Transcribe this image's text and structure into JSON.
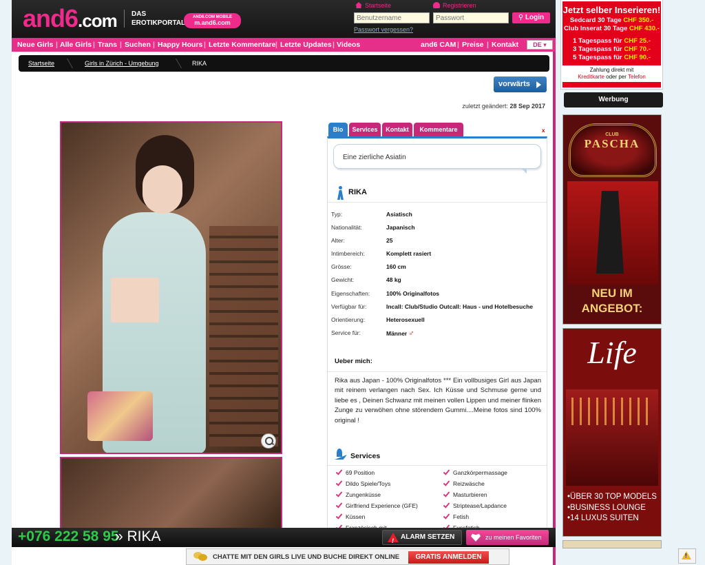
{
  "header": {
    "logo": "and6",
    "logo_tld": ".com",
    "tagline_1": "DAS",
    "tagline_2": "EROTIKPORTAL",
    "mobile_top": "AND6.COM MOBILE",
    "mobile_url": "m.and6.com",
    "link_home": "Startseite",
    "link_register": "Registrieren",
    "username_placeholder": "Benutzername",
    "password_placeholder": "Passwort",
    "login_label": "Login",
    "forgot_label": "Passwort vergessen?"
  },
  "nav": {
    "items": [
      "Neue Girls",
      "Alle Girls",
      "Trans",
      "Suchen",
      "Happy Hours",
      "Letzte Kommentare",
      "Letzte Updates",
      "Videos"
    ],
    "right_items": [
      "and6 CAM",
      "Preise",
      "Kontakt"
    ],
    "lang": "DE"
  },
  "breadcrumb": [
    "Startseite",
    "Girls in Zürich - Umgebung",
    "RIKA"
  ],
  "forward_label": "vorwärts",
  "modified_prefix": "zuletzt geändert:",
  "modified_date": "28 Sep 2017",
  "tabs": [
    "Bio",
    "Services",
    "Kontakt",
    "Kommentare"
  ],
  "tab_close": "x",
  "profile": {
    "tagline": "Eine zierliche Asiatin",
    "name": "RIKA",
    "attributes": [
      {
        "k": "Typ:",
        "v": "Asiatisch"
      },
      {
        "k": "Nationalität:",
        "v": "Japanisch"
      },
      {
        "k": "Alter:",
        "v": "25"
      },
      {
        "k": "Intimbereich:",
        "v": "Komplett rasiert"
      },
      {
        "k": "Grösse:",
        "v": "160 cm"
      },
      {
        "k": "Gewicht:",
        "v": "48 kg"
      },
      {
        "k": "Eigenschaften:",
        "v": "100% Originalfotos"
      },
      {
        "k": "Verfügbar für:",
        "v": "Incall: Club/Studio Outcall: Haus - und Hotelbesuche"
      },
      {
        "k": "Orientierung:",
        "v": "Heterosexuell"
      },
      {
        "k": "Service für:",
        "v": "Männer"
      }
    ],
    "about_title": "Ueber mich:",
    "about_text": "Rika aus Japan - 100% Originalfotos *** Ein vollbusiges Girl aus Japan mit reinem verlangen nach Sex. Ich Küsse und Schmuse gerne und liebe es , Deinen Schwanz mit meinen vollen Lippen und meiner flinken Zunge zu verwöhen ohne störendem Gummi....Meine fotos sind 100% original !",
    "services_title": "Services",
    "services_left": [
      "69 Position",
      "Dildo Spiele/Toys",
      "Zungenküsse",
      "Girlfriend Experience (GFE)",
      "Küssen",
      "Französisch mit"
    ],
    "services_right": [
      "Ganzkörpermassage",
      "Reizwäsche",
      "Masturbieren",
      "Striptease/Lapdance",
      "Fetish",
      "Fussfetish"
    ]
  },
  "bottom_bar": {
    "phone": "+076 222 58 95",
    "name": "» RIKA",
    "alarm_label": "ALARM SETZEN",
    "fav_label": "zu meinen Favoriten"
  },
  "chat_bar": {
    "text": "CHATTE MIT DEN GIRLS LIVE UND BUCHE DIREKT ONLINE",
    "button": "GRATIS ANMELDEN"
  },
  "ads": {
    "top_title": "Jetzt selber Inserieren!",
    "top_line1": "Sedcard 30 Tage",
    "top_line1_price": "CHF 350.-",
    "top_line2": "Club Inserat 30 Tage",
    "top_line2_price": "CHF 430.-",
    "pass1": "1 Tagespass für",
    "pass1_price": "CHF 25.-",
    "pass2": "3 Tagespass für",
    "pass2_price": "CHF 70.-",
    "pass3": "5 Tagespass für",
    "pass3_price": "CHF 90.-",
    "pay1": "Zahlung direkt mit",
    "pay2a": "Kreditkarte",
    "pay2b": "oder per",
    "pay2c": "Telefon",
    "werbung": "Werbung",
    "pascha_club": "CLUB",
    "pascha_brand": "PASCHA",
    "pascha_footer_1": "NEU IM",
    "pascha_footer_2": "ANGEBOT:",
    "life_brand": "Life",
    "life_bullets": [
      "ÜBER 30 TOP MODELS",
      "BUSINESS LOUNGE",
      "14 LUXUS SUITEN"
    ]
  },
  "colors": {
    "accent": "#e62f88",
    "blue": "#2b7fc8",
    "phone_green": "#2cc94a"
  }
}
